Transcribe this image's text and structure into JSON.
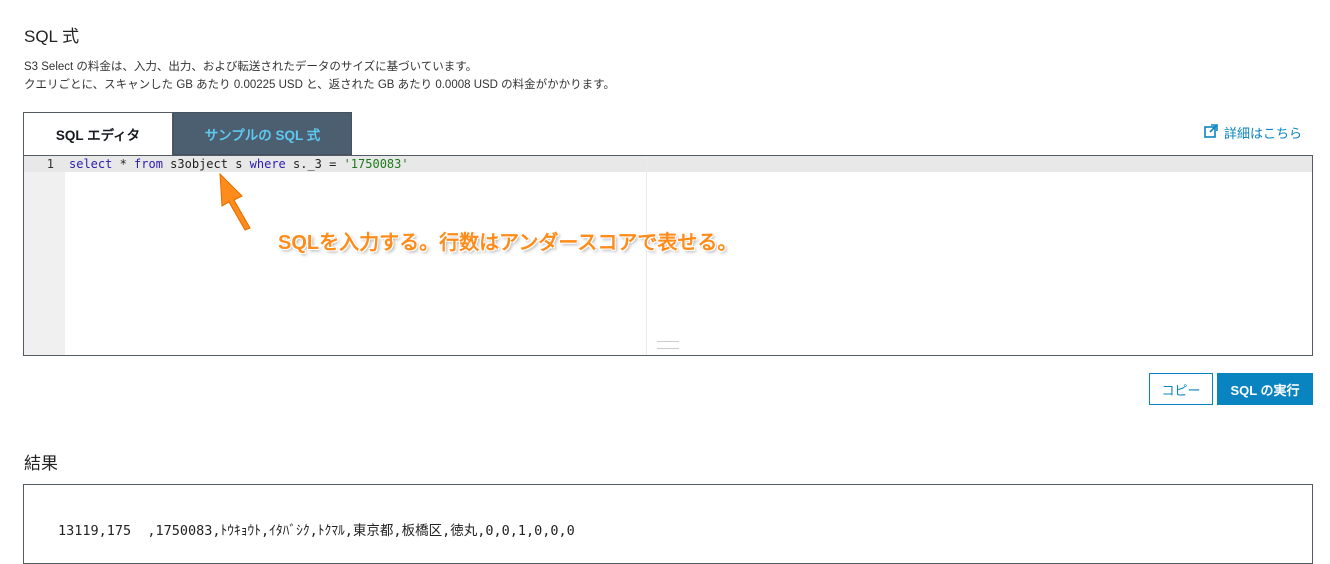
{
  "header": {
    "title": "SQL 式",
    "desc_line1": "S3 Select の料金は、入力、出力、および転送されたデータのサイズに基づいています。",
    "desc_line2": "クエリごとに、スキャンした GB あたり 0.00225 USD と、返された GB あたり 0.0008 USD の料金がかかります。"
  },
  "tabs": {
    "editor_label": "SQL エディタ",
    "sample_label": "サンプルの SQL 式"
  },
  "details_link": {
    "label": "詳細はこちら",
    "icon": "external-link-icon"
  },
  "editor": {
    "line_number": "1",
    "code": {
      "t1": "select",
      "t2": " * ",
      "t3": "from",
      "t4": " s3object s ",
      "t5": "where",
      "t6": " s._3 = ",
      "t7": "'1750083'"
    }
  },
  "annotation": {
    "text": "SQLを入力する。行数はアンダースコアで表せる。",
    "color": "#ff8c1a"
  },
  "buttons": {
    "copy_label": "コピー",
    "run_label": "SQL の実行"
  },
  "results": {
    "title": "結果",
    "row": "13119,175  ,1750083,ﾄｳｷｮｳﾄ,ｲﾀﾊﾞｼｸ,ﾄｸﾏﾙ,東京都,板橋区,徳丸,0,0,1,0,0,0"
  },
  "colors": {
    "accent": "#0a84c1",
    "tab_dark": "#4b5f70",
    "tab_text": "#5ec8f0"
  }
}
